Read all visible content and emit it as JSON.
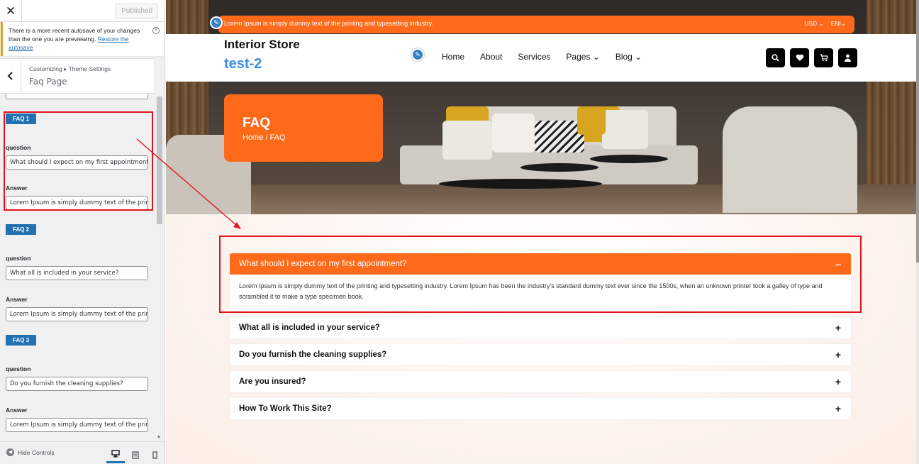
{
  "panel": {
    "close_icon": "close-icon",
    "publish_label": "Published",
    "autosave": {
      "message": "There is a more recent autosave of your changes than the one you are previewing.",
      "restore_label": "Restore the autosave"
    },
    "breadcrumb": "Customizing ▸ Theme Settings",
    "section_title": "Faq Page",
    "faqs": [
      {
        "badge": "FAQ 1",
        "question_label": "question",
        "question_value": "What should I expect on my first appointment?",
        "answer_label": "Answer",
        "answer_value": "Lorem Ipsum is simply dummy text of the printing"
      },
      {
        "badge": "FAQ 2",
        "question_label": "question",
        "question_value": "What all is included in your service?",
        "answer_label": "Answer",
        "answer_value": "Lorem Ipsum is simply dummy text of the printing"
      },
      {
        "badge": "FAQ 3",
        "question_label": "question",
        "question_value": "Do you furnish the cleaning supplies?",
        "answer_label": "Answer",
        "answer_value": "Lorem Ipsum is simply dummy text of the printing"
      }
    ],
    "hide_controls_label": "Hide Controls",
    "devices": [
      "desktop-icon",
      "tablet-icon",
      "mobile-icon"
    ]
  },
  "site": {
    "topbar_text": "Lorem Ipsum is simply dummy text of the printing and typesetting industry.",
    "currency": "USD",
    "language": "ENI",
    "store_name": "Interior Store",
    "store_sub": "test-2",
    "nav": [
      "Home",
      "About",
      "Services",
      "Pages",
      "Blog"
    ],
    "header_icons": [
      "search-icon",
      "heart-icon",
      "cart-icon",
      "user-icon"
    ],
    "page_title": "FAQ",
    "page_crumb": "Home / FAQ",
    "accordion": [
      {
        "question": "What should I expect on my first appointment?",
        "open": true,
        "sign": "–",
        "answer": "Lorem Ipsum is simply dummy text of the printing and typesetting industry. Lorem Ipsum has been the industry's standard dummy text ever since the 1500s, when an unknown printer took a galley of type and scrambled it to make a type specimen book."
      },
      {
        "question": "What all is included in your service?",
        "open": false,
        "sign": "+"
      },
      {
        "question": "Do you furnish the cleaning supplies?",
        "open": false,
        "sign": "+"
      },
      {
        "question": "Are you insured?",
        "open": false,
        "sign": "+"
      },
      {
        "question": "How To Work This Site?",
        "open": false,
        "sign": "+"
      }
    ]
  },
  "colors": {
    "accent": "#ff6a1a",
    "link": "#2271b1",
    "annotation": "#e4141e"
  }
}
